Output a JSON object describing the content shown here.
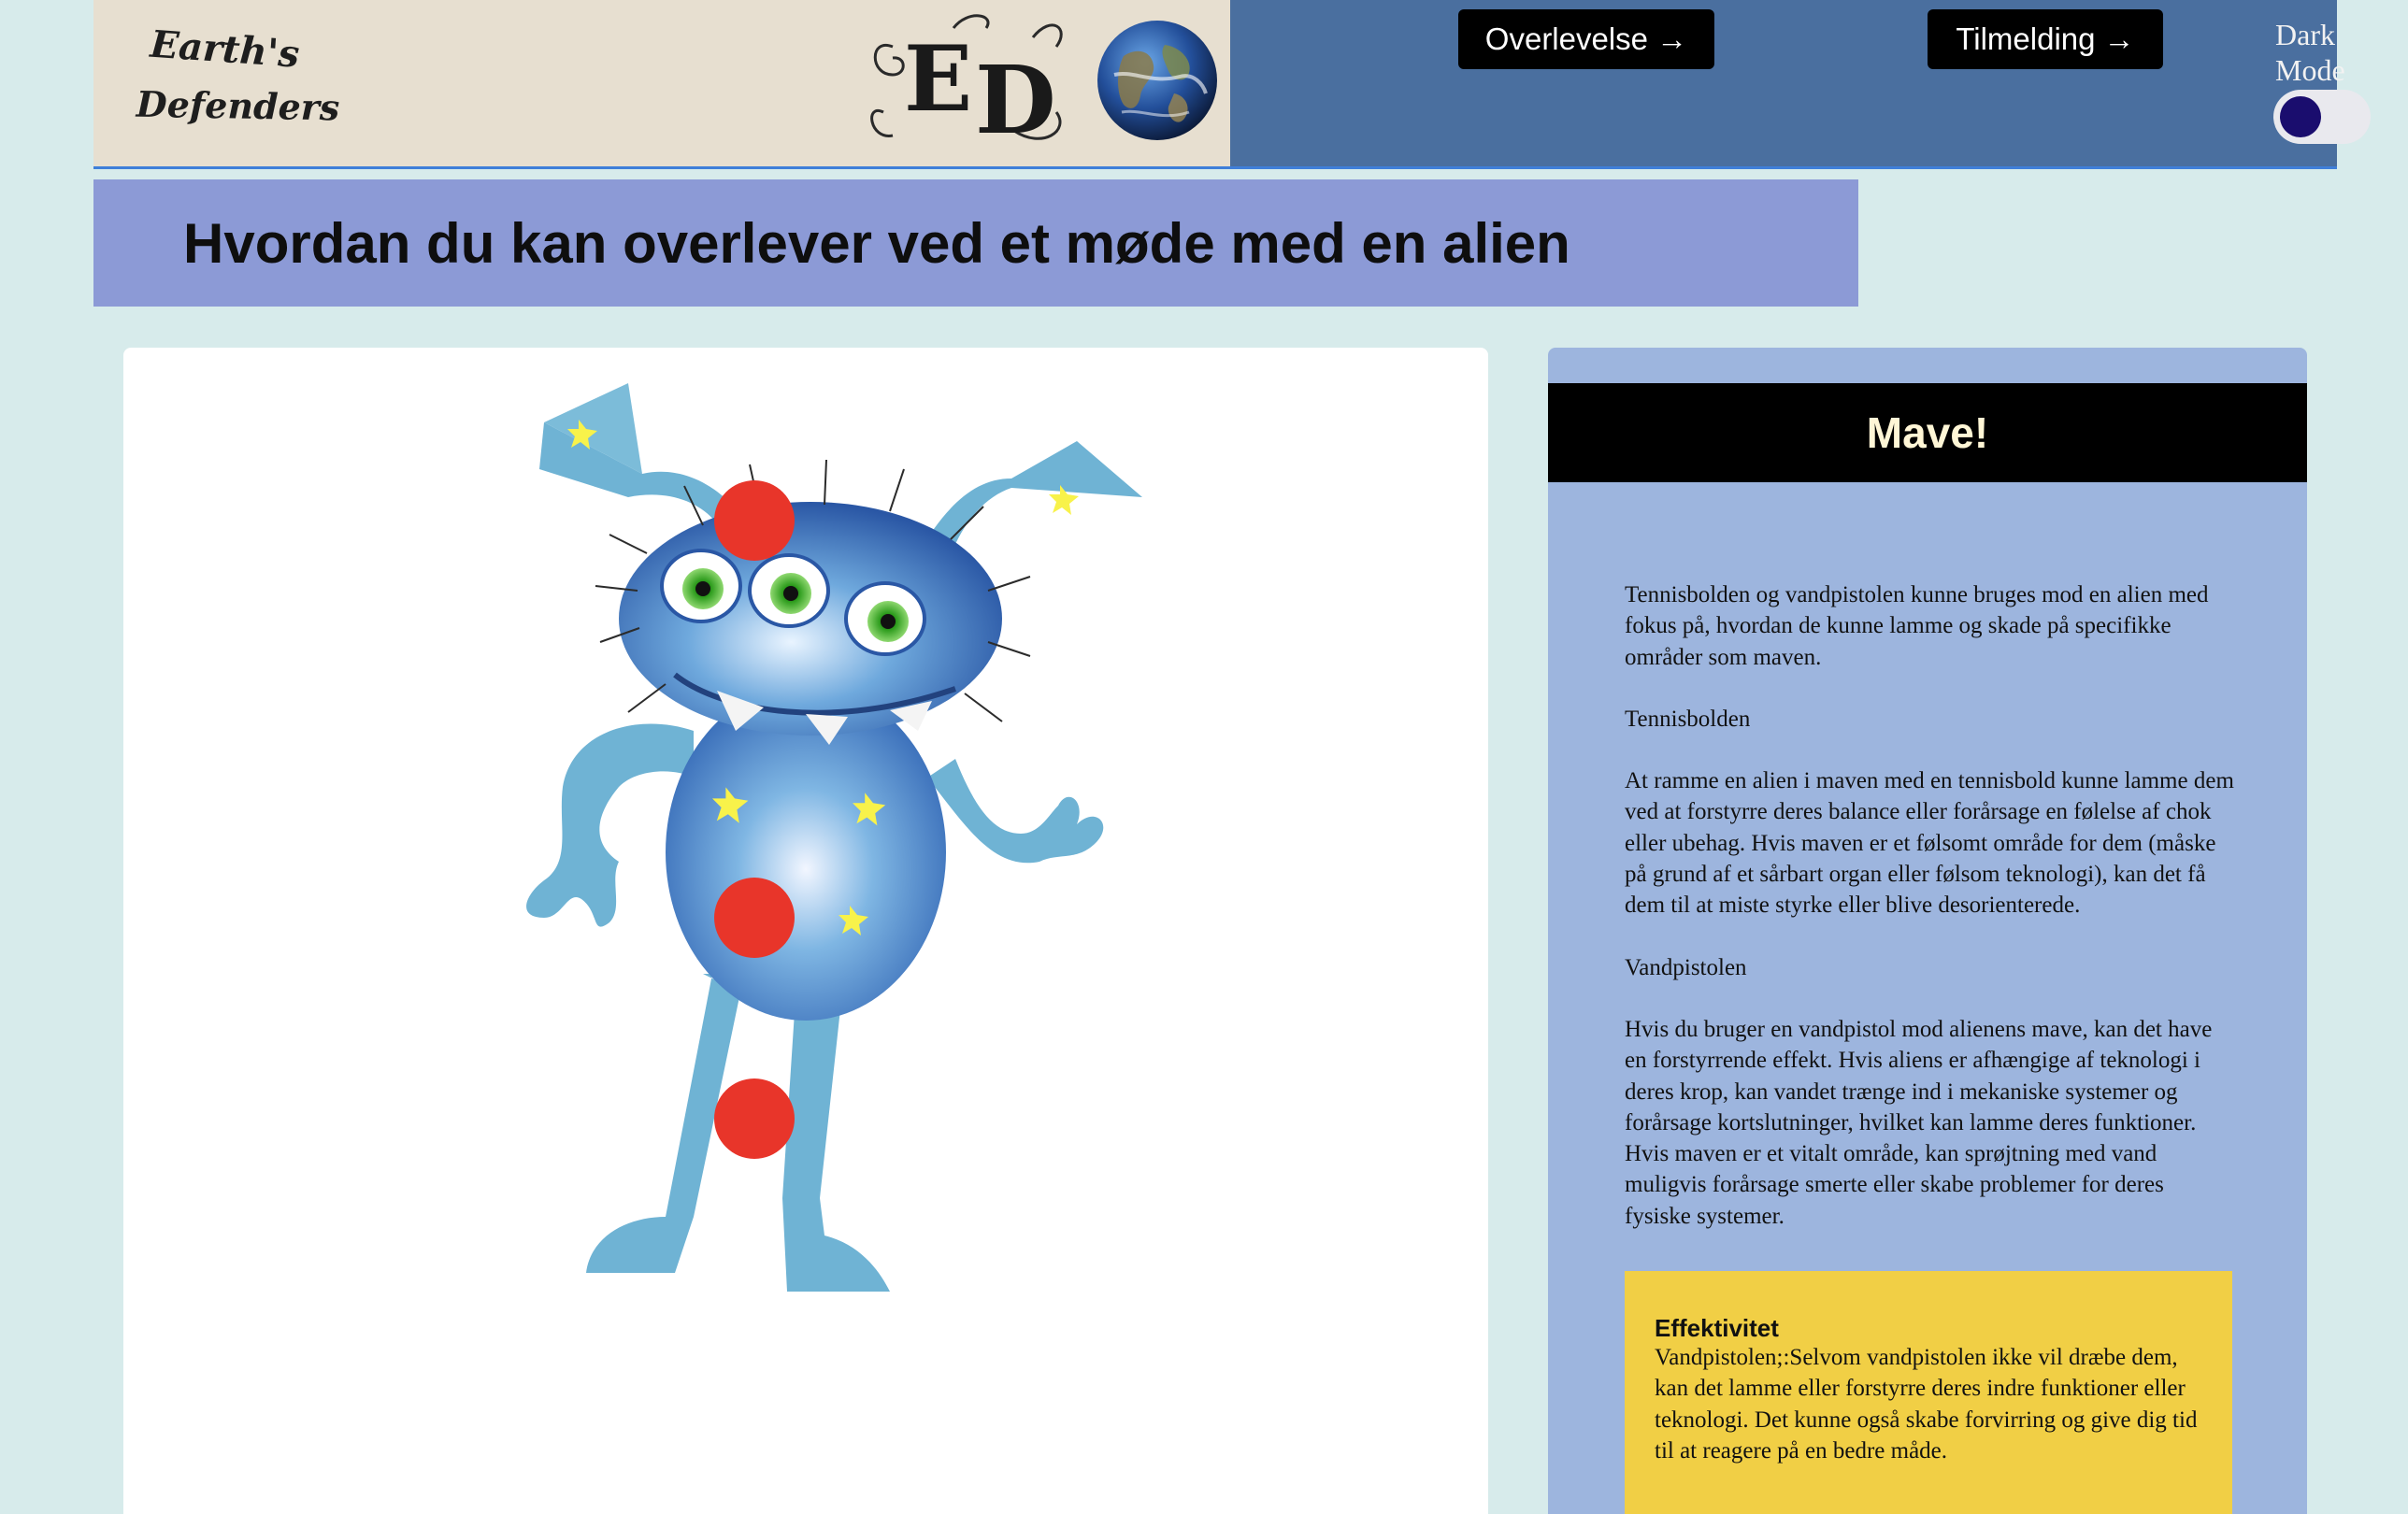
{
  "header": {
    "logo": {
      "line1": "Earth's",
      "line2": "Defenders",
      "monogram": "ED"
    },
    "nav": {
      "survival_label": "Overlevelse →",
      "signup_label": "Tilmelding →"
    },
    "dark_mode": {
      "label": "Dark Mode",
      "enabled": false
    }
  },
  "page": {
    "title": "Hvordan du kan overlever ved et møde med en alien"
  },
  "illustration": {
    "subject": "alien-illustration",
    "markers": [
      "head",
      "stomach",
      "knee"
    ],
    "marker_color": "#e8352a"
  },
  "panel": {
    "heading": "Mave!",
    "paragraphs": [
      "Tennisbolden og vandpistolen kunne bruges mod en alien med fokus på, hvordan de kunne lamme og skade på specifikke områder som maven.",
      "Tennisbolden",
      "At ramme en alien i maven med en tennisbold kunne lamme dem ved at forstyrre deres balance eller forårsage en følelse af chok eller ubehag. Hvis maven er et følsomt område for dem (måske på grund af et sårbart organ eller følsom teknologi), kan det få dem til at miste styrke eller blive desorienterede.",
      "Vandpistolen",
      "Hvis du bruger en vandpistol mod alienens mave, kan det have en forstyrrende effekt. Hvis aliens er afhængige af teknologi i deres krop, kan vandet trænge ind i mekaniske systemer og forårsage kortslutninger, hvilket kan lamme deres funktioner. Hvis maven er et vitalt område, kan sprøjtning med vand muligvis forårsage smerte eller skabe problemer for deres fysiske systemer."
    ],
    "effect": {
      "title": "Effektivitet",
      "text": "Vandpistolen;:Selvom vandpistolen ikke vil dræbe dem, kan det lamme eller forstyrre deres indre funktioner eller teknologi. Det kunne også skabe forvirring og give dig tid til at reagere på en bedre måde."
    }
  },
  "colors": {
    "page_bg": "#d7ebeb",
    "nav_bg": "#4a6f9f",
    "title_bg": "#8c9ad6",
    "panel_bg": "#9db5de",
    "effect_bg": "#f1cf45"
  }
}
